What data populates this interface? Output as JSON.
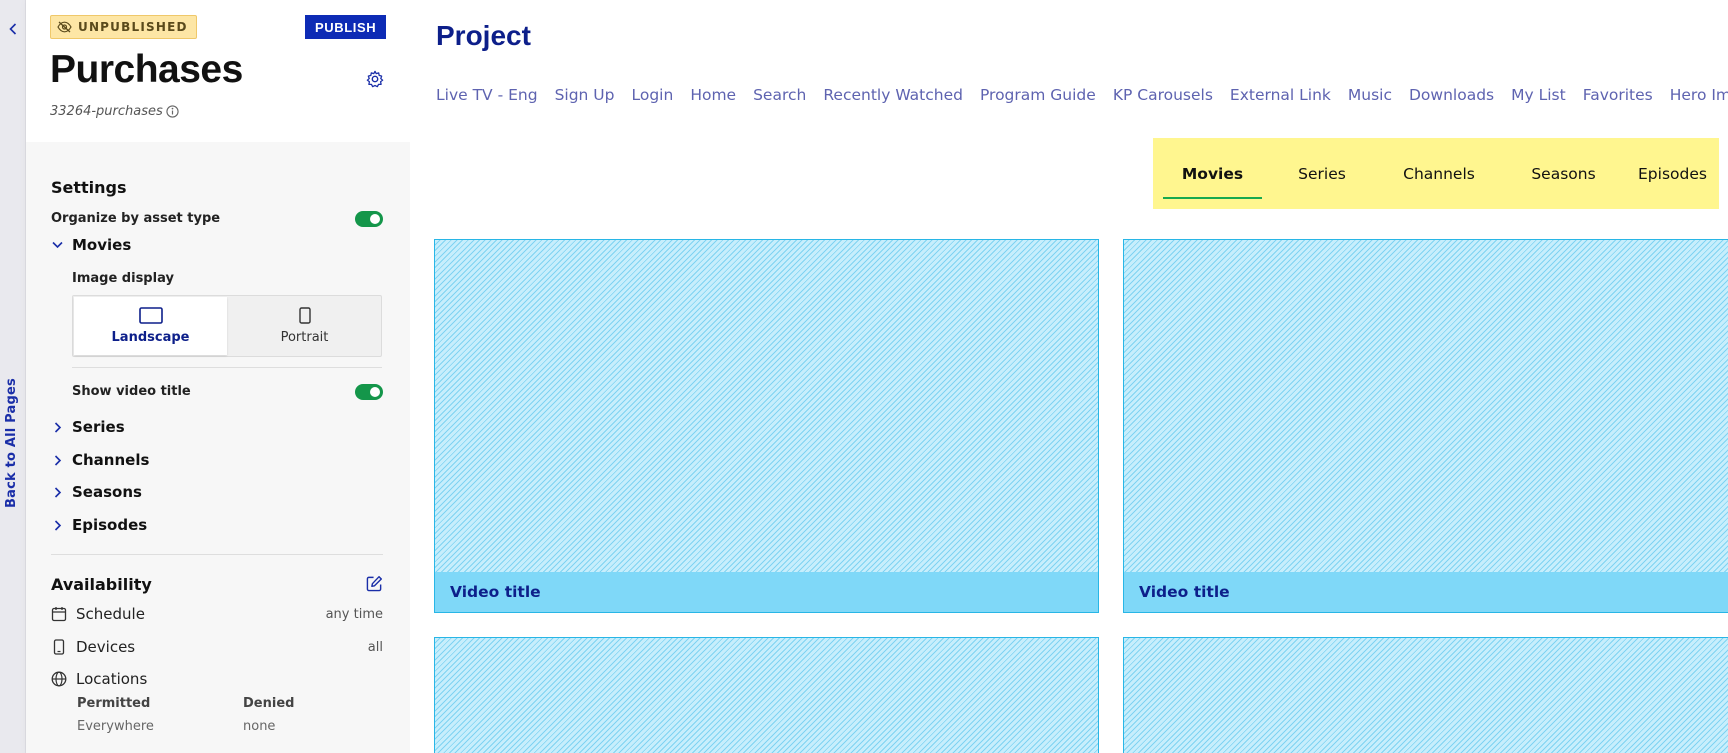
{
  "rail": {
    "back_label": "Back to All Pages"
  },
  "header": {
    "status": "UNPUBLISHED",
    "publish_label": "PUBLISH",
    "title": "Purchases",
    "slug": "33264-purchases"
  },
  "settings": {
    "title": "Settings",
    "organize_label": "Organize by asset type",
    "organize_on": true,
    "movies": {
      "label": "Movies",
      "image_display_label": "Image display",
      "options": [
        {
          "label": "Landscape",
          "icon": "landscape-icon",
          "selected": true
        },
        {
          "label": "Portrait",
          "icon": "portrait-icon",
          "selected": false
        }
      ],
      "show_title_label": "Show video title",
      "show_title_on": true
    },
    "collapsed_items": [
      "Series",
      "Channels",
      "Seasons",
      "Episodes"
    ]
  },
  "availability": {
    "title": "Availability",
    "rows": [
      {
        "label": "Schedule",
        "value": "any time",
        "icon": "calendar-icon"
      },
      {
        "label": "Devices",
        "value": "all",
        "icon": "device-icon"
      },
      {
        "label": "Locations",
        "value": "",
        "icon": "globe-icon"
      }
    ],
    "permitted_label": "Permitted",
    "permitted_value": "Everywhere",
    "denied_label": "Denied",
    "denied_value": "none"
  },
  "main": {
    "title": "Project",
    "nav": [
      "Live TV - Eng",
      "Sign Up",
      "Login",
      "Home",
      "Search",
      "Recently Watched",
      "Program Guide",
      "KP Carousels",
      "External Link",
      "Music",
      "Downloads",
      "My List",
      "Favorites",
      "Hero Image"
    ],
    "tabs": [
      {
        "label": "Movies",
        "active": true
      },
      {
        "label": "Series",
        "active": false
      },
      {
        "label": "Channels",
        "active": false
      },
      {
        "label": "Seasons",
        "active": false
      },
      {
        "label": "Episodes",
        "active": false
      }
    ],
    "cards": [
      {
        "title": "Video title"
      },
      {
        "title": "Video title"
      },
      {
        "title": ""
      },
      {
        "title": ""
      }
    ]
  },
  "colors": {
    "brand_blue": "#0d2bb5",
    "toggle_green": "#14964a",
    "tab_bar_yellow": "#fff68f",
    "card_cyan": "#7fd8f8"
  }
}
